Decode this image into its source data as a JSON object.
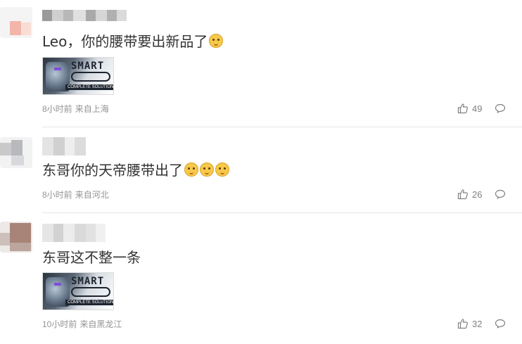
{
  "comments": [
    {
      "text": "Leo，你的腰带要出新品了",
      "emojis": [
        "doge"
      ],
      "has_image": true,
      "image_text": {
        "title": "SMART",
        "sub": "COMPLETE SOLUTION MODIFICATION"
      },
      "time": "8小时前",
      "location": "来自上海",
      "likes": "49"
    },
    {
      "text": "东哥你的天帝腰带出了",
      "emojis": [
        "doge",
        "doge",
        "doge"
      ],
      "has_image": false,
      "time": "8小时前",
      "location": "来自河北",
      "likes": "26"
    },
    {
      "text": "东哥这不整一条",
      "emojis": [],
      "has_image": true,
      "image_text": {
        "title": "SMART",
        "sub": "COMPLETE SOLUTION MODIFICATION"
      },
      "time": "10小时前",
      "location": "来自黑龙江",
      "likes": "32"
    }
  ],
  "icons": {
    "like": "thumbs-up-icon",
    "reply": "comment-bubble-icon",
    "emoji": "doge-emoji"
  },
  "colors": {
    "text": "#333333",
    "meta": "#939393",
    "divider": "#e6e6e6",
    "icon": "#808080"
  }
}
